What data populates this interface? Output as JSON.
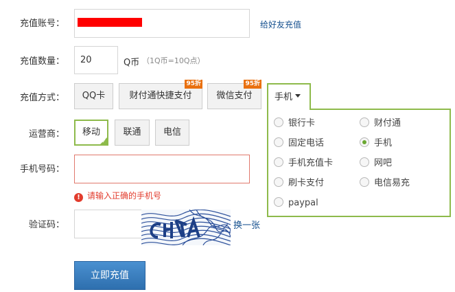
{
  "account": {
    "label": "充值账号：",
    "friend_link": "给好友充值"
  },
  "quantity": {
    "label": "充值数量：",
    "value": "20",
    "unit": "Q币",
    "note": "（1Q币=10Q点）"
  },
  "method": {
    "label": "充值方式：",
    "options": [
      {
        "label": "QQ卡",
        "badge": ""
      },
      {
        "label": "财付通快捷支付",
        "badge": "95折"
      },
      {
        "label": "微信支付",
        "badge": "95折"
      }
    ],
    "dropdown_selected": "手机",
    "dropdown_items": [
      {
        "label": "银行卡",
        "checked": false
      },
      {
        "label": "财付通",
        "checked": false
      },
      {
        "label": "固定电话",
        "checked": false
      },
      {
        "label": "手机",
        "checked": true
      },
      {
        "label": "手机充值卡",
        "checked": false
      },
      {
        "label": "网吧",
        "checked": false
      },
      {
        "label": "刷卡支付",
        "checked": false
      },
      {
        "label": "电信易充",
        "checked": false
      },
      {
        "label": "paypal",
        "checked": false
      }
    ]
  },
  "carrier": {
    "label": "运营商：",
    "options": [
      "移动",
      "联通",
      "电信"
    ],
    "selected": "移动"
  },
  "phone": {
    "label": "手机号码：",
    "value": "",
    "error": "请输入正确的手机号"
  },
  "captcha": {
    "label": "验证码：",
    "value": "",
    "refresh_link": "换一张"
  },
  "submit": {
    "label": "立即充值"
  },
  "colors": {
    "accent_green": "#8dba4a",
    "link_blue": "#15508f",
    "error_red": "#e23c2d",
    "badge_orange": "#e9700f",
    "button_blue": "#3a7fc4"
  }
}
